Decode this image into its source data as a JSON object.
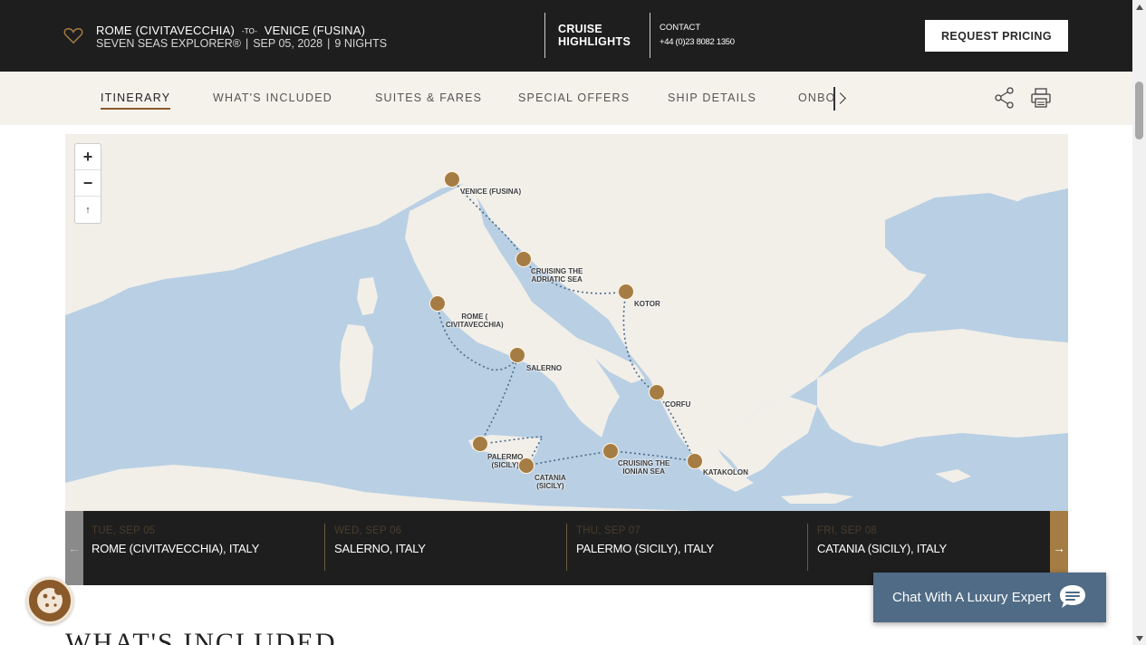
{
  "header": {
    "origin": "ROME (CIVITAVECCHIA)",
    "to_label": "-TO-",
    "destination": "VENICE (FUSINA)",
    "ship": "SEVEN SEAS EXPLORER®",
    "date": "SEP 05, 2028",
    "nights": "9 NIGHTS",
    "separator": "|",
    "highlights_line1": "CRUISE",
    "highlights_line2": "HIGHLIGHTS",
    "contact_label": "CONTACT",
    "contact_phone": "+44 (0)23 8082 1350",
    "request_button": "REQUEST PRICING"
  },
  "nav": {
    "items": [
      {
        "label": "ITINERARY",
        "active": true
      },
      {
        "label": "WHAT'S INCLUDED",
        "active": false
      },
      {
        "label": "SUITES & FARES",
        "active": false
      },
      {
        "label": "SPECIAL OFFERS",
        "active": false
      },
      {
        "label": "SHIP DETAILS",
        "active": false
      },
      {
        "label": "ONBOARD",
        "active": false
      }
    ],
    "share_icon": "share-icon",
    "print_icon": "print-icon"
  },
  "map": {
    "zoom_in": "+",
    "zoom_out": "−",
    "reset": "↑",
    "labels": {
      "venice": "VENICE (FUSINA)",
      "adriatic_1": "CRUISING THE",
      "adriatic_2": "ADRIATIC SEA",
      "kotor": "KOTOR",
      "rome_1": "ROME (",
      "rome_2": "CIVITAVECCHIA)",
      "salerno": "SALERNO",
      "corfu": "CORFU",
      "palermo_1": "PALERMO",
      "palermo_2": "(SICILY)",
      "catania_1": "CATANIA",
      "catania_2": "(SICILY)",
      "ionian_1": "CRUISING THE",
      "ionian_2": "IONIAN SEA",
      "katakolon": "KATAKOLON"
    },
    "colors": {
      "water": "#b9cfe3",
      "land": "#f2efe9",
      "port_marker": "#a57c43",
      "route": "#4a6a8a"
    }
  },
  "days": {
    "prev": "←",
    "next": "→",
    "items": [
      {
        "date": "TUE, SEP 05",
        "port": "ROME (CIVITAVECCHIA), ITALY"
      },
      {
        "date": "WED, SEP 06",
        "port": "SALERNO, ITALY"
      },
      {
        "date": "THU, SEP 07",
        "port": "PALERMO (SICILY), ITALY"
      },
      {
        "date": "FRI, SEP 08",
        "port": "CATANIA (SICILY), ITALY"
      }
    ]
  },
  "section": {
    "title": "WHAT'S INCLUDED"
  },
  "chat": {
    "label": "Chat With A Luxury Expert",
    "icon": "chat-bubble-icon"
  },
  "cookie": {
    "icon": "cookie-icon"
  }
}
